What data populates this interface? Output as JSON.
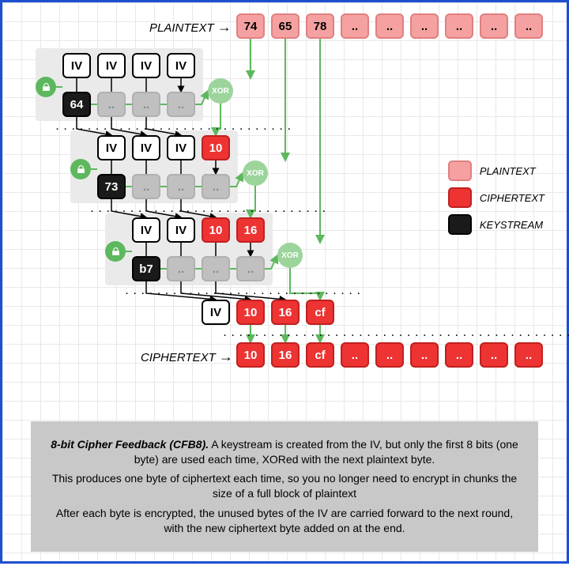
{
  "title_label": "PLAINTEXT",
  "cipher_label": "CIPHERTEXT",
  "xor_label": "XOR",
  "iv_label": "IV",
  "dots": "..",
  "plaintext_bytes": [
    "74",
    "65",
    "78"
  ],
  "ciphertext_bytes": [
    "10",
    "16",
    "cf"
  ],
  "rounds": [
    {
      "input": [
        "IV",
        "IV",
        "IV",
        "IV"
      ],
      "input_type": [
        "iv",
        "iv",
        "iv",
        "iv"
      ],
      "keystream": "64"
    },
    {
      "input": [
        "IV",
        "IV",
        "IV",
        "10"
      ],
      "input_type": [
        "iv",
        "iv",
        "iv",
        "ct"
      ],
      "keystream": "73"
    },
    {
      "input": [
        "IV",
        "IV",
        "10",
        "16"
      ],
      "input_type": [
        "iv",
        "iv",
        "ct",
        "ct"
      ],
      "keystream": "b7"
    }
  ],
  "final_row": [
    "IV",
    "10",
    "16",
    "cf"
  ],
  "final_type": [
    "iv",
    "ct",
    "ct",
    "ct"
  ],
  "legend": [
    {
      "label": "PLAINTEXT",
      "class": "plaintext"
    },
    {
      "label": "CIPHERTEXT",
      "class": "ciphertext"
    },
    {
      "label": "KEYSTREAM",
      "class": "keystream"
    }
  ],
  "caption": {
    "p1_title": "8-bit Cipher Feedback (CFB8).",
    "p1_rest": " A keystream is created from the IV, but only the first 8 bits (one byte) are used each time, XORed with the next plaintext byte.",
    "p2": "This produces one byte of ciphertext each time, so you no longer need to encrypt in chunks the size of a full block of plaintext",
    "p3": "After each byte is encrypted, the unused bytes of the IV are carried forward to the next round, with the new ciphertext byte added on at the end."
  }
}
